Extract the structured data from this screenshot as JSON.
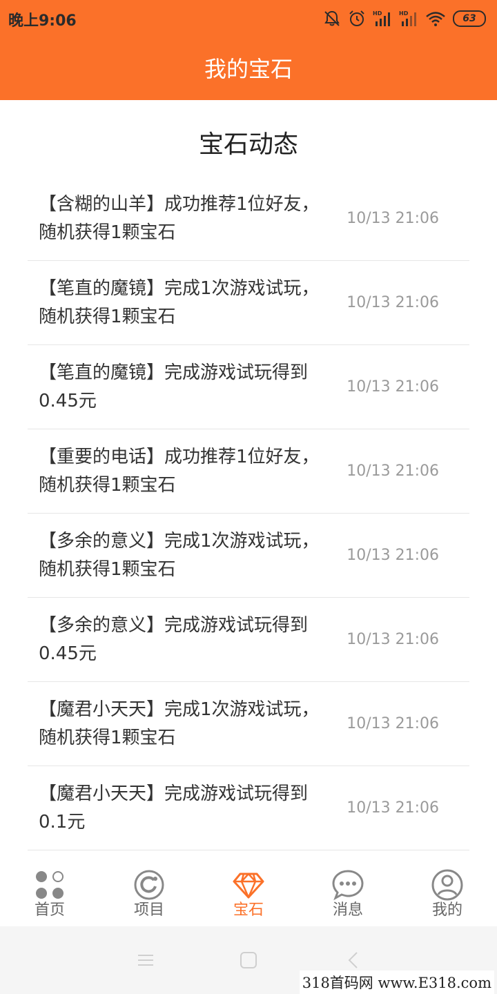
{
  "status_bar": {
    "time": "晚上9:06",
    "battery": "63",
    "icons": [
      "mute-icon",
      "alarm-icon",
      "hd-signal-icon",
      "hd-signal-icon",
      "wifi-icon",
      "battery-icon"
    ]
  },
  "header": {
    "title": "我的宝石"
  },
  "section": {
    "title": "宝石动态"
  },
  "feed": [
    {
      "text": "【含糊的山羊】成功推荐1位好友，随机获得1颗宝石",
      "time": "10/13 21:06"
    },
    {
      "text": "【笔直的魔镜】完成1次游戏试玩，随机获得1颗宝石",
      "time": "10/13 21:06"
    },
    {
      "text": "【笔直的魔镜】完成游戏试玩得到0.45元",
      "time": "10/13 21:06"
    },
    {
      "text": "【重要的电话】成功推荐1位好友，随机获得1颗宝石",
      "time": "10/13 21:06"
    },
    {
      "text": "【多余的意义】完成1次游戏试玩，随机获得1颗宝石",
      "time": "10/13 21:06"
    },
    {
      "text": "【多余的意义】完成游戏试玩得到0.45元",
      "time": "10/13 21:06"
    },
    {
      "text": "【魔君小天天】完成1次游戏试玩，随机获得1颗宝石",
      "time": "10/13 21:06"
    },
    {
      "text": "【魔君小天天】完成游戏试玩得到0.1元",
      "time": "10/13 21:06"
    }
  ],
  "tabs": [
    {
      "label": "首页",
      "icon": "home-dots-icon",
      "active": false
    },
    {
      "label": "项目",
      "icon": "project-refresh-icon",
      "active": false
    },
    {
      "label": "宝石",
      "icon": "gem-icon",
      "active": true
    },
    {
      "label": "消息",
      "icon": "message-bubble-icon",
      "active": false
    },
    {
      "label": "我的",
      "icon": "profile-icon",
      "active": false
    }
  ],
  "colors": {
    "accent": "#FB7129",
    "tab_inactive": "#666666",
    "time_text": "#9a9a9a"
  },
  "watermark": "318首码网 www.E318.com"
}
